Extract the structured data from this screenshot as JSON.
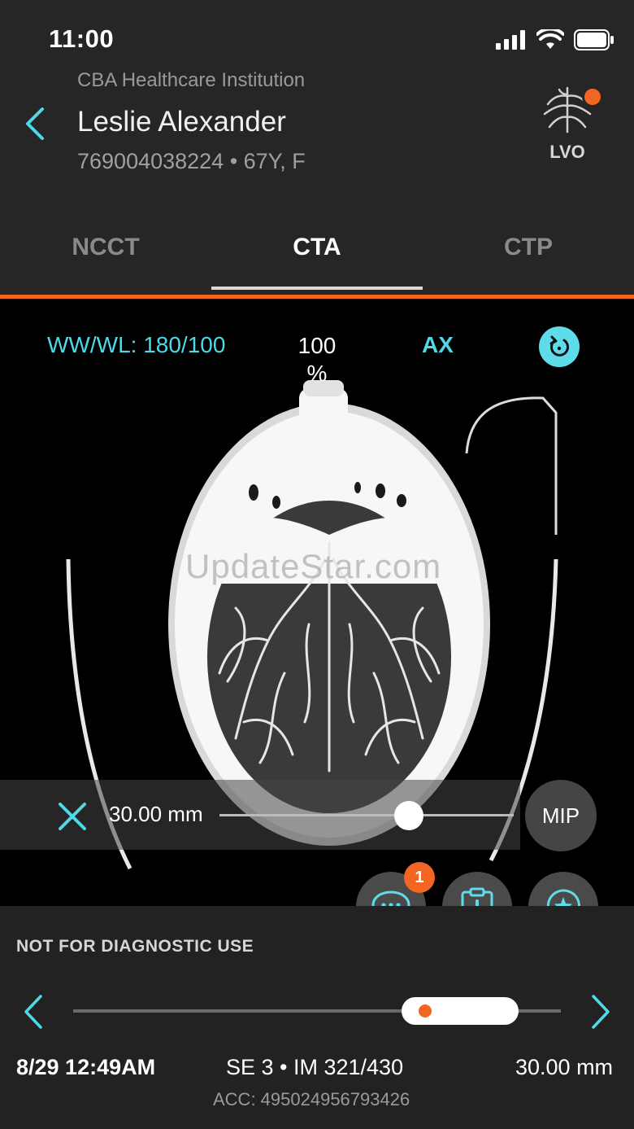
{
  "status_bar": {
    "time": "11:00"
  },
  "header": {
    "institution": "CBA Healthcare Institution",
    "patient_name": "Leslie Alexander",
    "patient_meta": "769004038224 • 67Y, F",
    "lvo_label": "LVO",
    "lvo_alert_color": "#f26522"
  },
  "tabs": [
    {
      "label": "NCCT",
      "active": false
    },
    {
      "label": "CTA",
      "active": true
    },
    {
      "label": "CTP",
      "active": false
    }
  ],
  "viewer": {
    "window_level": "WW/WL: 180/100",
    "zoom_value": "100",
    "zoom_unit": "%",
    "orientation": "AX",
    "watermark": "UpdateStar.com",
    "mip": {
      "thickness": "30.00 mm",
      "slider_level": 0.64,
      "button_label": "MIP"
    }
  },
  "actions": {
    "comments_badge": "1",
    "icons": [
      "chat-icon",
      "clipboard-plus-icon",
      "star-chat-icon"
    ]
  },
  "footer": {
    "disclaimer": "NOT FOR DIAGNOSTIC USE",
    "series_position": 0.72,
    "date": "8/29 12:49AM",
    "series_image": "SE 3 • IM 321/430",
    "slice_thickness": "30.00 mm",
    "accession": "ACC: 495024956793426"
  },
  "colors": {
    "accent": "#4fd9e6",
    "alert": "#f26522",
    "background": "#262626"
  }
}
